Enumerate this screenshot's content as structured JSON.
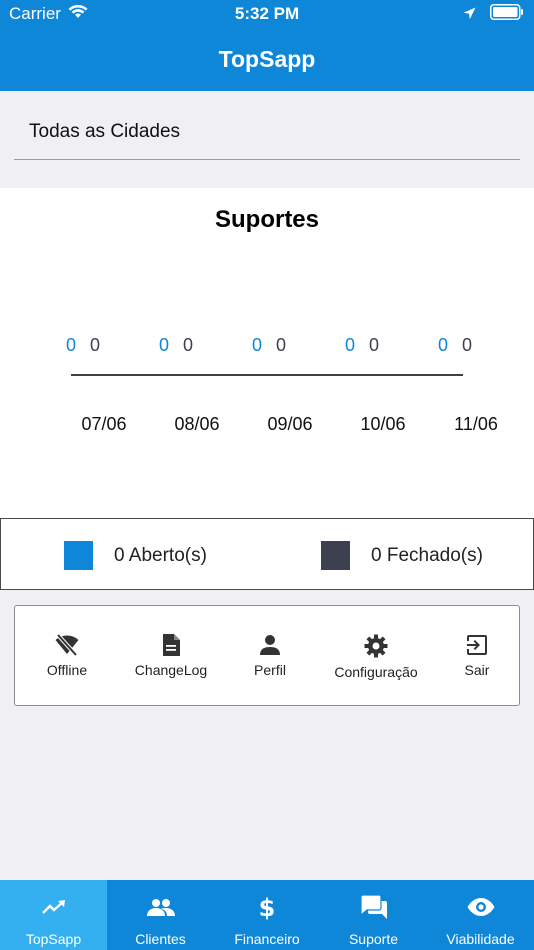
{
  "status_bar": {
    "carrier": "Carrier",
    "time": "5:32 PM"
  },
  "header": {
    "title": "TopSapp"
  },
  "city_filter": {
    "value": "Todas as Cidades"
  },
  "chart_data": {
    "type": "bar",
    "title": "Suportes",
    "categories": [
      "07/06",
      "08/06",
      "09/06",
      "10/06",
      "11/06"
    ],
    "series": [
      {
        "name": "Aberto(s)",
        "values": [
          0,
          0,
          0,
          0,
          0
        ],
        "color": "#0f87d8"
      },
      {
        "name": "Fechado(s)",
        "values": [
          0,
          0,
          0,
          0,
          0
        ],
        "color": "#3c4150"
      }
    ]
  },
  "legend": {
    "items": [
      {
        "count": "0",
        "label": "Aberto(s)",
        "text": "0 Aberto(s)",
        "color": "#0f87d8"
      },
      {
        "count": "0",
        "label": "Fechado(s)",
        "text": "0 Fechado(s)",
        "color": "#3c4150"
      }
    ]
  },
  "menu": {
    "items": [
      {
        "label": "Offline",
        "icon": "wifi-off-icon"
      },
      {
        "label": "ChangeLog",
        "icon": "document-icon"
      },
      {
        "label": "Perfil",
        "icon": "person-icon"
      },
      {
        "label": "Configuração",
        "icon": "gear-icon"
      },
      {
        "label": "Sair",
        "icon": "logout-icon"
      }
    ]
  },
  "tabbar": {
    "items": [
      {
        "label": "TopSapp",
        "icon": "trending-up-icon",
        "active": true
      },
      {
        "label": "Clientes",
        "icon": "people-icon",
        "active": false
      },
      {
        "label": "Financeiro",
        "icon": "dollar-icon",
        "active": false
      },
      {
        "label": "Suporte",
        "icon": "chat-icon",
        "active": false
      },
      {
        "label": "Viabilidade",
        "icon": "eye-icon",
        "active": false
      }
    ]
  },
  "colors": {
    "primary": "#0f87d8",
    "tab_active": "#34b0f0",
    "closed": "#3c4150",
    "background": "#efeff4"
  }
}
